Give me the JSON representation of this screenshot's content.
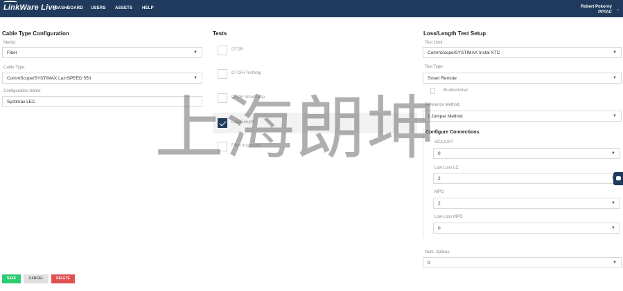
{
  "header": {
    "logo_text": "LinkWare Live",
    "nav": [
      "DASHBOARD",
      "USERS",
      "ASSETS",
      "HELP"
    ],
    "user_name": "Robert Pokorny",
    "user_org": "PPTAC"
  },
  "cable_config": {
    "title": "Cable Type Configuration",
    "media_label": "Media:",
    "media_value": "Fiber",
    "cable_type_label": "Cable Type:",
    "cable_type_value": "CommScope/SYSTIMAX LazrSPEED 550",
    "config_name_label": "Configuration Name:",
    "config_name_value": "Systimax LEC"
  },
  "tests": {
    "title": "Tests",
    "items": [
      {
        "label": "OTDR",
        "checked": false
      },
      {
        "label": "OTDR+TestMap",
        "checked": false
      },
      {
        "label": "OTDR SmartLoop",
        "checked": false
      },
      {
        "label": "Loss/Length",
        "checked": true
      },
      {
        "label": "Fiber Inspection",
        "checked": false
      }
    ]
  },
  "loss_setup": {
    "title": "Loss/Length Test Setup",
    "test_limit_label": "Test Limit:",
    "test_limit_value": "CommScope/SYSTIMAX Instal XTC",
    "test_type_label": "Test Type:",
    "test_type_value": "Smart Remote",
    "bidirectional_label": "Bi-directional",
    "reference_label": "Reference Method:",
    "reference_value": "1 Jumper Method",
    "connections_title": "Configure Connections",
    "connections": [
      {
        "label": "SC/LC/ST",
        "value": "0"
      },
      {
        "label": "Low Loss LC",
        "value": "2"
      },
      {
        "label": "MPO",
        "value": "2"
      },
      {
        "label": "Low Loss MPO",
        "value": "0"
      }
    ],
    "splices_label": "Num. Splices:",
    "splices_value": "0"
  },
  "buttons": {
    "save": "SAVE",
    "cancel": "CANCEL",
    "delete": "DELETE"
  },
  "colors": {
    "header_bg": "#1f3a5c",
    "save": "#2ecc71",
    "cancel": "#e0e0e0",
    "delete": "#e05252"
  },
  "watermark": "上海朗坤"
}
